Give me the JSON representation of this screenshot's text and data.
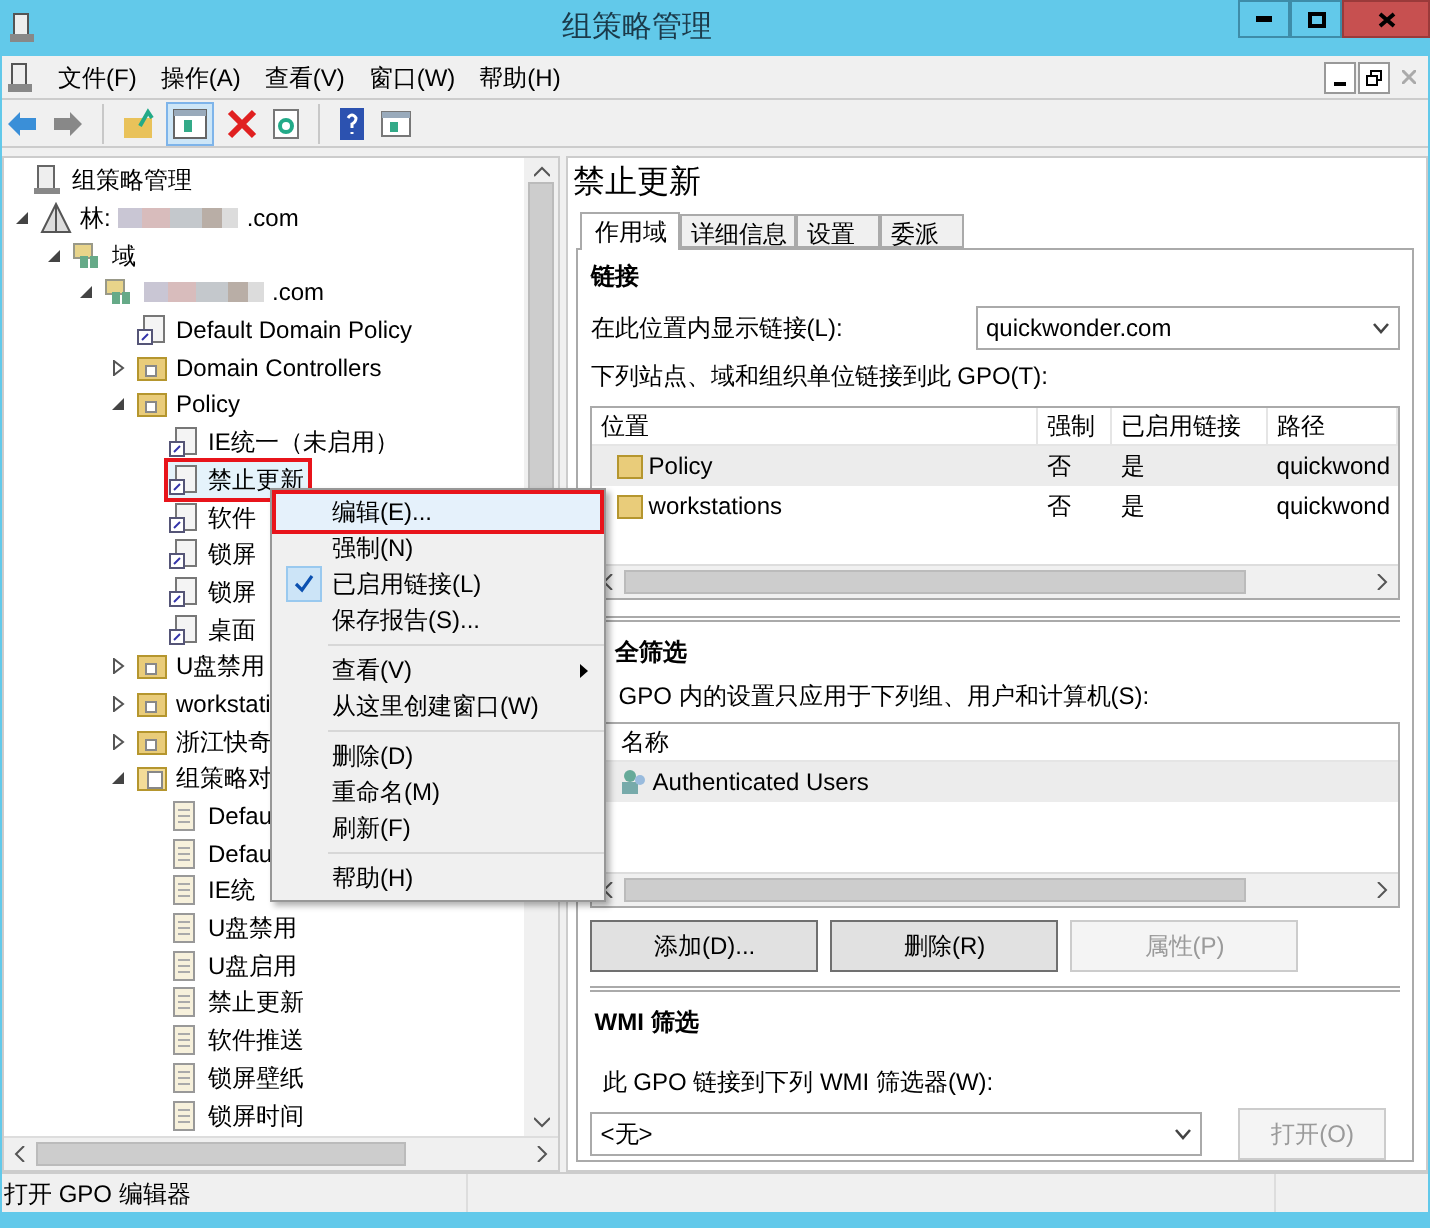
{
  "window": {
    "title": "组策略管理"
  },
  "menu_bar": [
    "文件(F)",
    "操作(A)",
    "查看(V)",
    "窗口(W)",
    "帮助(H)"
  ],
  "toolbar": [
    {
      "kind": "back"
    },
    {
      "kind": "forward"
    },
    {
      "kind": "separator"
    },
    {
      "kind": "up"
    },
    {
      "kind": "pane",
      "selected": true
    },
    {
      "kind": "delete"
    },
    {
      "kind": "refresh"
    },
    {
      "kind": "separator"
    },
    {
      "kind": "help"
    },
    {
      "kind": "panel"
    }
  ],
  "tree": [
    {
      "label": "组策略管理",
      "kind": "root",
      "selected": false,
      "children": [
        {
          "label": "林:",
          "label_end": ".com",
          "kind": "forest",
          "expanded": true,
          "selected": false,
          "children": [
            {
              "label": "域",
              "kind": "domains",
              "expanded": true,
              "selected": false,
              "children": [
                {
                  "label_end": ".com",
                  "kind": "domain",
                  "expanded": true,
                  "selected": false,
                  "children": [
                    {
                      "label": "Default Domain Policy",
                      "kind": "link",
                      "selected": false
                    },
                    {
                      "label": "Domain Controllers",
                      "kind": "ou",
                      "expanded": false,
                      "selected": false
                    },
                    {
                      "label": "Policy",
                      "kind": "ou",
                      "expanded": true,
                      "selected": false,
                      "children": [
                        {
                          "label": "IE统一（未启用）",
                          "kind": "link",
                          "selected": false
                        },
                        {
                          "label": "禁止更新",
                          "kind": "link",
                          "selected": true
                        },
                        {
                          "label": "软件",
                          "kind": "link",
                          "selected": false
                        },
                        {
                          "label": "锁屏",
                          "kind": "link",
                          "selected": false
                        },
                        {
                          "label": "锁屏",
                          "kind": "link",
                          "selected": false
                        },
                        {
                          "label": "桌面",
                          "kind": "link",
                          "selected": false
                        }
                      ]
                    },
                    {
                      "label": "U盘禁用",
                      "kind": "ou",
                      "expanded": false,
                      "selected": false
                    },
                    {
                      "label": "workstati",
                      "kind": "ou",
                      "expanded": false,
                      "selected": false
                    },
                    {
                      "label": "浙江快奇",
                      "kind": "ou",
                      "expanded": false,
                      "selected": false
                    },
                    {
                      "label": "组策略对",
                      "kind": "gpo-folder",
                      "expanded": true,
                      "selected": false,
                      "children": [
                        {
                          "label": "Defau",
                          "kind": "gpo",
                          "selected": false
                        },
                        {
                          "label": "Defau",
                          "kind": "gpo",
                          "selected": false
                        },
                        {
                          "label": "IE统",
                          "kind": "gpo",
                          "selected": false
                        },
                        {
                          "label": "U盘禁用",
                          "kind": "gpo",
                          "selected": false
                        },
                        {
                          "label": "U盘启用",
                          "kind": "gpo",
                          "selected": false
                        },
                        {
                          "label": "禁止更新",
                          "kind": "gpo",
                          "selected": false
                        },
                        {
                          "label": "软件推送",
                          "kind": "gpo",
                          "selected": false
                        },
                        {
                          "label": "锁屏壁纸",
                          "kind": "gpo",
                          "selected": false
                        },
                        {
                          "label": "锁屏时间",
                          "kind": "gpo",
                          "selected": false
                        }
                      ]
                    }
                  ]
                }
              ]
            }
          ]
        }
      ]
    }
  ],
  "context_menu": [
    {
      "kind": "item",
      "label": "编辑(E)...",
      "selected": true,
      "checked": false,
      "submenu": false
    },
    {
      "kind": "item",
      "label": "强制(N)",
      "selected": false,
      "checked": false,
      "submenu": false
    },
    {
      "kind": "item",
      "label": "已启用链接(L)",
      "selected": false,
      "checked": true,
      "submenu": false
    },
    {
      "kind": "item",
      "label": "保存报告(S)...",
      "selected": false,
      "checked": false,
      "submenu": false
    },
    {
      "kind": "separator"
    },
    {
      "kind": "item",
      "label": "查看(V)",
      "selected": false,
      "checked": false,
      "submenu": true
    },
    {
      "kind": "item",
      "label": "从这里创建窗口(W)",
      "selected": false,
      "checked": false,
      "submenu": false
    },
    {
      "kind": "separator"
    },
    {
      "kind": "item",
      "label": "删除(D)",
      "selected": false,
      "checked": false,
      "submenu": false
    },
    {
      "kind": "item",
      "label": "重命名(M)",
      "selected": false,
      "checked": false,
      "submenu": false
    },
    {
      "kind": "item",
      "label": "刷新(F)",
      "selected": false,
      "checked": false,
      "submenu": false
    },
    {
      "kind": "separator"
    },
    {
      "kind": "item",
      "label": "帮助(H)",
      "selected": false,
      "checked": false,
      "submenu": false
    }
  ],
  "details": {
    "title": "禁止更新",
    "tabs": [
      {
        "label": "作用域",
        "selected": true
      },
      {
        "label": "详细信息",
        "selected": false
      },
      {
        "label": "设置",
        "selected": false
      },
      {
        "label": "委派",
        "selected": false
      }
    ],
    "links": {
      "heading": "链接",
      "location_label": "在此位置内显示链接(L):",
      "location_value": "quickwonder.com",
      "list_label": "下列站点、域和组织单位链接到此 GPO(T):",
      "columns": [
        "位置",
        "强制",
        "已启用链接",
        "路径"
      ],
      "rows": [
        {
          "cells": [
            "Policy",
            "否",
            "是",
            "quickwond"
          ],
          "selected": true
        },
        {
          "cells": [
            "workstations",
            "否",
            "是",
            "quickwond"
          ],
          "selected": false
        }
      ]
    },
    "security": {
      "heading": "全筛选",
      "text": "GPO 内的设置只应用于下列组、用户和计算机(S):",
      "columns": [
        "名称"
      ],
      "rows": [
        {
          "cells": [
            "Authenticated Users"
          ],
          "selected": true
        }
      ],
      "buttons": [
        {
          "label": "添加(D)...",
          "disabled": false
        },
        {
          "label": "删除(R)",
          "disabled": false
        },
        {
          "label": "属性(P)",
          "disabled": true
        }
      ]
    },
    "wmi": {
      "heading": "WMI 筛选",
      "text": "此 GPO 链接到下列 WMI 筛选器(W):",
      "value": "<无>",
      "button": {
        "label": "打开(O)",
        "disabled": true
      }
    }
  },
  "status_bar": "打开 GPO 编辑器"
}
